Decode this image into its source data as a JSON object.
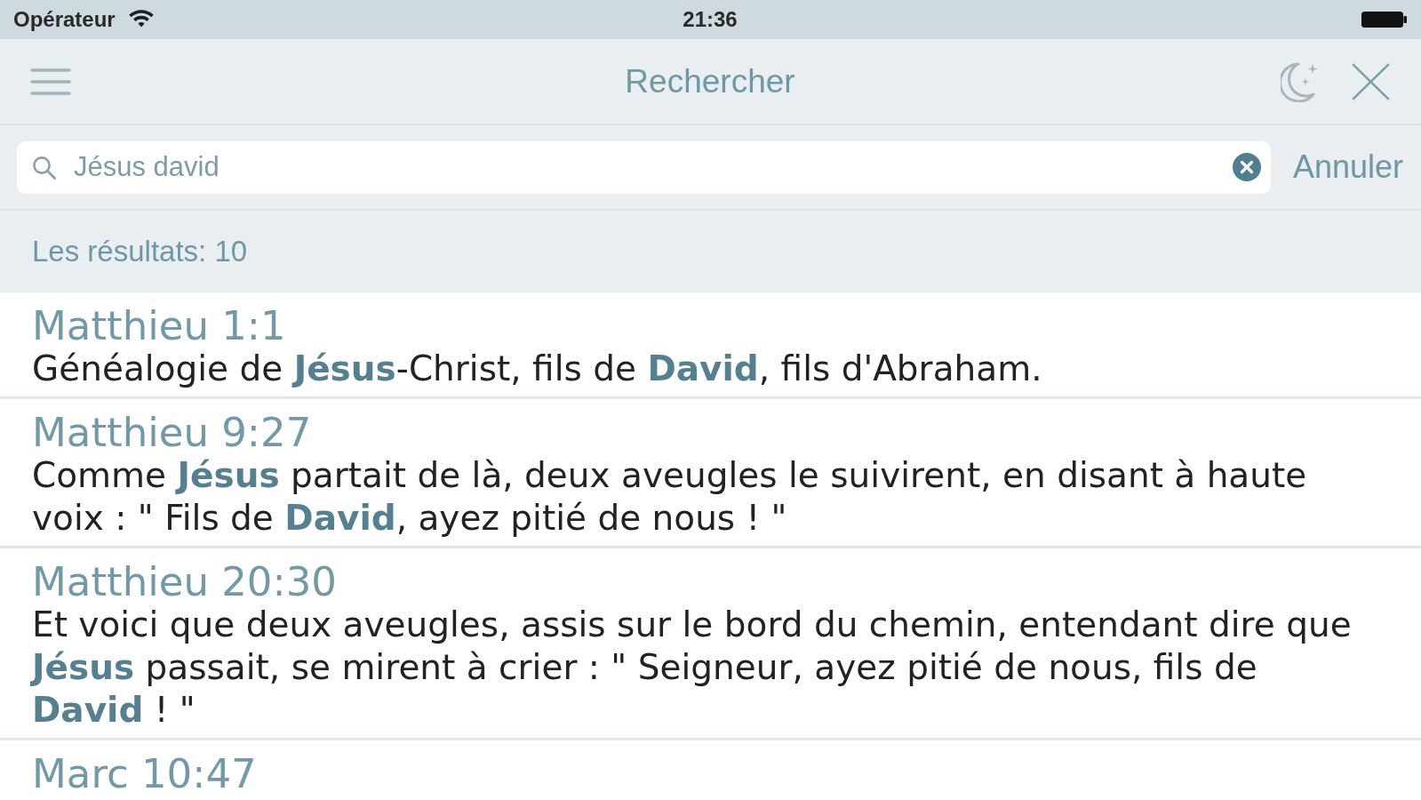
{
  "status_bar": {
    "carrier": "Opérateur",
    "time": "21:36"
  },
  "nav_bar": {
    "title": "Rechercher"
  },
  "search": {
    "value": "Jésus david",
    "cancel": "Annuler"
  },
  "results_header": "Les résultats: 10",
  "results": [
    {
      "reference": "Matthieu 1:1",
      "verse": "Généalogie de **Jésus**-Christ, fils de **David**, fils d'Abraham."
    },
    {
      "reference": "Matthieu 9:27",
      "verse": "Comme **Jésus** partait de là, deux aveugles le suivirent, en disant à haute voix : \" Fils de **David**, ayez pitié de nous ! \""
    },
    {
      "reference": "Matthieu 20:30",
      "verse": "Et voici que deux aveugles, assis sur le bord du chemin, entendant dire que **Jésus** passait, se mirent à crier : \" Seigneur, ayez pitié de nous, fils de **David** ! \""
    },
    {
      "reference": "Marc 10:47"
    }
  ]
}
